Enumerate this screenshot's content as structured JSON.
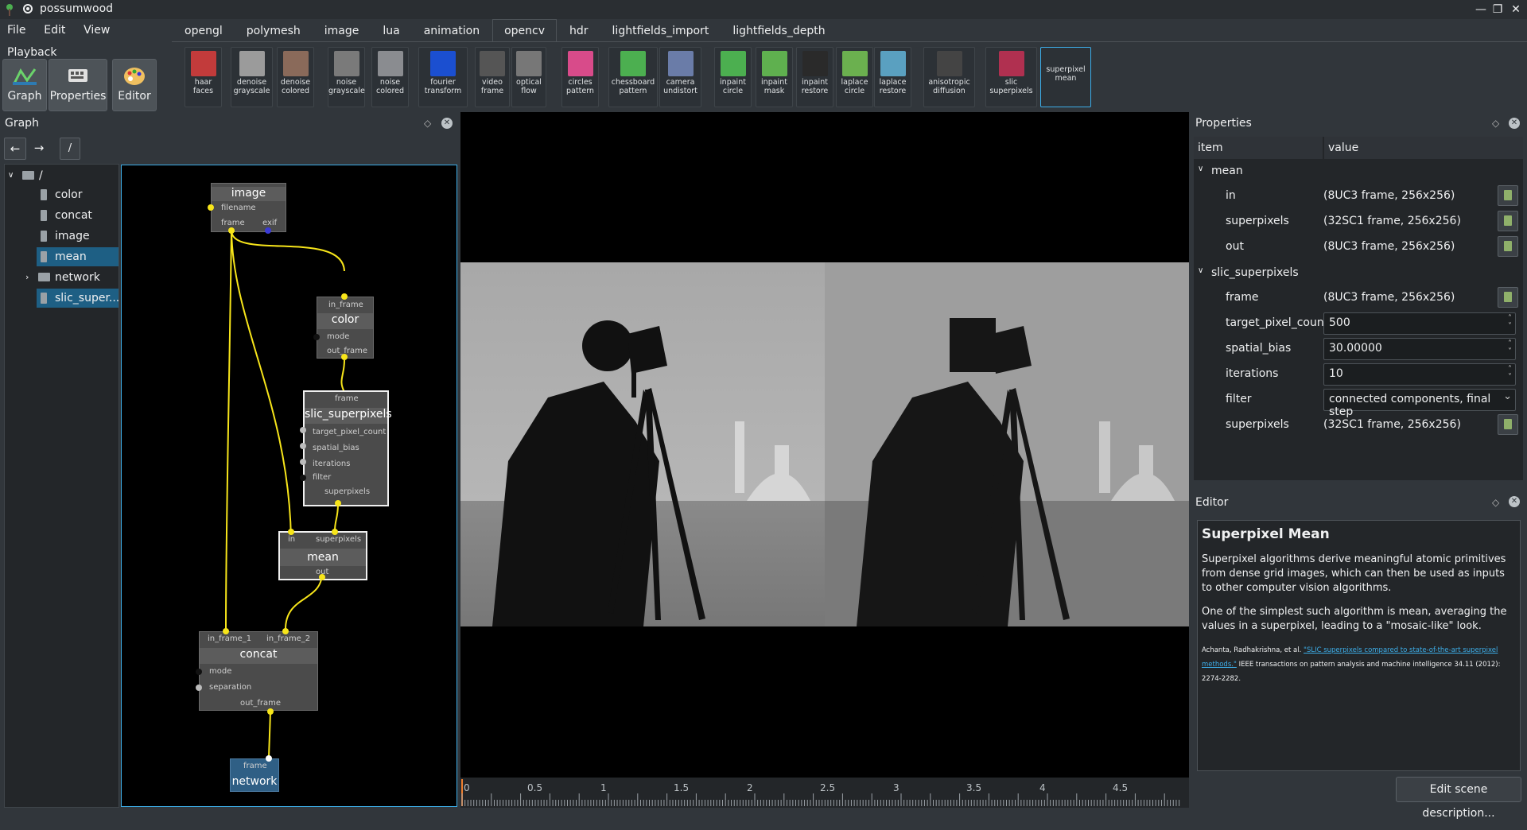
{
  "window": {
    "title": "possumwood"
  },
  "menu": [
    "File",
    "Edit",
    "View",
    "Playback"
  ],
  "tabs": [
    "opengl",
    "polymesh",
    "image",
    "lua",
    "animation",
    "opencv",
    "hdr",
    "lightfields_import",
    "lightfields_depth"
  ],
  "active_tab": "opencv",
  "tools": [
    {
      "l1": "haar",
      "l2": "faces"
    },
    {
      "l1": "denoise",
      "l2": "grayscale"
    },
    {
      "l1": "denoise",
      "l2": "colored"
    },
    {
      "l1": "noise",
      "l2": "grayscale"
    },
    {
      "l1": "noise",
      "l2": "colored"
    },
    {
      "l1": "fourier",
      "l2": "transform"
    },
    {
      "l1": "video",
      "l2": "frame"
    },
    {
      "l1": "optical",
      "l2": "flow"
    },
    {
      "l1": "circles",
      "l2": "pattern"
    },
    {
      "l1": "chessboard",
      "l2": "pattern"
    },
    {
      "l1": "camera",
      "l2": "undistort"
    },
    {
      "l1": "inpaint",
      "l2": "circle"
    },
    {
      "l1": "inpaint",
      "l2": "mask"
    },
    {
      "l1": "inpaint",
      "l2": "restore"
    },
    {
      "l1": "laplace",
      "l2": "circle"
    },
    {
      "l1": "laplace",
      "l2": "restore"
    },
    {
      "l1": "anisotropic",
      "l2": "diffusion"
    },
    {
      "l1": "slic",
      "l2": "superpixels"
    },
    {
      "l1": "superpixel",
      "l2": "mean"
    }
  ],
  "modes": [
    "Graph",
    "Properties",
    "Editor"
  ],
  "graph_panel": {
    "title": "Graph",
    "path": "/",
    "tree": [
      {
        "label": "/"
      },
      {
        "label": "color"
      },
      {
        "label": "concat"
      },
      {
        "label": "image"
      },
      {
        "label": "mean"
      },
      {
        "label": "network"
      },
      {
        "label": "slic_super..."
      }
    ]
  },
  "nodes": {
    "image": {
      "title": "image",
      "ports": [
        "filename",
        "frame",
        "exif"
      ]
    },
    "color": {
      "title": "color",
      "ports": [
        "in_frame",
        "mode",
        "out_frame"
      ]
    },
    "slic": {
      "title": "slic_superpixels",
      "ports": [
        "frame",
        "target_pixel_count",
        "spatial_bias",
        "iterations",
        "filter",
        "superpixels"
      ]
    },
    "mean": {
      "title": "mean",
      "ports": [
        "in",
        "superpixels",
        "out"
      ]
    },
    "concat": {
      "title": "concat",
      "ports": [
        "in_frame_1",
        "in_frame_2",
        "mode",
        "separation",
        "out_frame"
      ]
    },
    "network": {
      "title": "network",
      "ports": [
        "frame"
      ]
    }
  },
  "timeline": {
    "ticks": [
      "0",
      "0.5",
      "1",
      "1.5",
      "2",
      "2.5",
      "3",
      "3.5",
      "4",
      "4.5"
    ]
  },
  "properties": {
    "title": "Properties",
    "col_item": "item",
    "col_value": "value",
    "rows": [
      {
        "key": "mean",
        "value": "",
        "group": true
      },
      {
        "key": "in",
        "value": "(8UC3 frame, 256x256)"
      },
      {
        "key": "superpixels",
        "value": "(32SC1 frame, 256x256)"
      },
      {
        "key": "out",
        "value": "(8UC3 frame, 256x256)"
      },
      {
        "key": "slic_superpixels",
        "value": "",
        "group": true
      },
      {
        "key": "frame",
        "value": "(8UC3 frame, 256x256)"
      },
      {
        "key": "target_pixel_count",
        "value": "500"
      },
      {
        "key": "spatial_bias",
        "value": "30.00000"
      },
      {
        "key": "iterations",
        "value": "10"
      },
      {
        "key": "filter",
        "value": "connected components, final step"
      },
      {
        "key": "superpixels",
        "value": "(32SC1 frame, 256x256)"
      }
    ]
  },
  "editor": {
    "title": "Editor",
    "heading": "Superpixel Mean",
    "p1": "Superpixel algorithms derive meaningful atomic primitives from dense grid images, which can then be used as inputs to other computer vision algorithms.",
    "p2": "One of the simplest such algorithm is mean, averaging the values in a superpixel, leading to a \"mosaic-like\" look.",
    "ref_prefix": "Achanta, Radhakrishna, et al. ",
    "ref_link": "\"SLIC superpixels compared to state-of-the-art superpixel methods.\"",
    "ref_suffix": " IEEE transactions on pattern analysis and machine intelligence 34.11 (2012): 2274-2282.",
    "button": "Edit scene description..."
  },
  "colors": {
    "accent": "#3daee9",
    "selection": "#1e5f84",
    "connection": "#f7e51a",
    "background": "#31363b"
  }
}
